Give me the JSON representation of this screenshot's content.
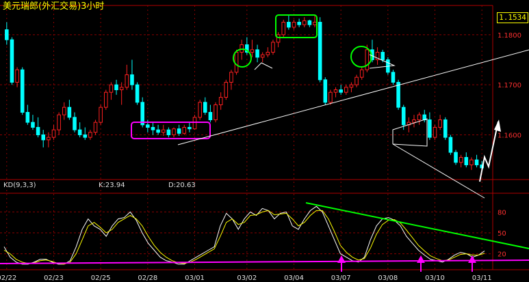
{
  "window": {
    "title": "美元瑞郎(外汇交易)3小时",
    "current_price": "1.1534"
  },
  "indicator": {
    "name": "KD(9,3,3)",
    "k_label": "K:23.94",
    "d_label": "D:20.63"
  },
  "colors": {
    "background": "#000000",
    "grid": "#8b0000",
    "up_candle": "#ff2020",
    "down_candle": "#00ffff",
    "title": "#ffff00",
    "k_line": "#ffffff",
    "d_line": "#ffff00",
    "annotation_green": "#00ff00",
    "annotation_magenta": "#ff00ff",
    "trendline": "#ffffff"
  },
  "chart_data": [
    {
      "type": "candlestick",
      "x_tick_labels": [
        "02/22",
        "02/23",
        "02/25",
        "02/28",
        "03/01",
        "03/02",
        "03/04",
        "03/07",
        "03/08",
        "03/10",
        "03/11"
      ],
      "y_tick_labels": [
        "1.1800",
        "1.1700",
        "1.1600"
      ],
      "ylim": [
        1.1512,
        1.1853
      ],
      "candles": [
        [
          1.181,
          1.1825,
          1.178,
          1.179
        ],
        [
          1.179,
          1.1795,
          1.17,
          1.1705
        ],
        [
          1.1705,
          1.1735,
          1.1695,
          1.173
        ],
        [
          1.173,
          1.1735,
          1.164,
          1.1645
        ],
        [
          1.1645,
          1.166,
          1.162,
          1.1625
        ],
        [
          1.1625,
          1.164,
          1.161,
          1.1615
        ],
        [
          1.1615,
          1.1635,
          1.1595,
          1.16
        ],
        [
          1.16,
          1.161,
          1.1575,
          1.159
        ],
        [
          1.159,
          1.1605,
          1.1575,
          1.1595
        ],
        [
          1.1595,
          1.162,
          1.159,
          1.161
        ],
        [
          1.161,
          1.1645,
          1.16,
          1.164
        ],
        [
          1.164,
          1.1665,
          1.163,
          1.1655
        ],
        [
          1.1655,
          1.167,
          1.163,
          1.1635
        ],
        [
          1.1635,
          1.1645,
          1.1605,
          1.161
        ],
        [
          1.161,
          1.1625,
          1.1595,
          1.16
        ],
        [
          1.16,
          1.1615,
          1.159,
          1.1595
        ],
        [
          1.1595,
          1.161,
          1.159,
          1.1605
        ],
        [
          1.1605,
          1.163,
          1.16,
          1.1625
        ],
        [
          1.1625,
          1.166,
          1.162,
          1.1655
        ],
        [
          1.1655,
          1.169,
          1.165,
          1.1685
        ],
        [
          1.1685,
          1.1705,
          1.167,
          1.17
        ],
        [
          1.17,
          1.171,
          1.168,
          1.169
        ],
        [
          1.169,
          1.1705,
          1.166,
          1.1695
        ],
        [
          1.1695,
          1.174,
          1.169,
          1.172
        ],
        [
          1.172,
          1.175,
          1.169,
          1.17
        ],
        [
          1.17,
          1.1705,
          1.166,
          1.1665
        ],
        [
          1.1665,
          1.1675,
          1.1615,
          1.162
        ],
        [
          1.162,
          1.163,
          1.1605,
          1.1615
        ],
        [
          1.1615,
          1.1625,
          1.16,
          1.161
        ],
        [
          1.161,
          1.162,
          1.16,
          1.1605
        ],
        [
          1.1605,
          1.162,
          1.1598,
          1.161
        ],
        [
          1.161,
          1.1615,
          1.1595,
          1.16
        ],
        [
          1.16,
          1.1615,
          1.1595,
          1.1612
        ],
        [
          1.1612,
          1.162,
          1.1598,
          1.1603
        ],
        [
          1.1603,
          1.162,
          1.16,
          1.1615
        ],
        [
          1.1615,
          1.1625,
          1.1605,
          1.1612
        ],
        [
          1.1612,
          1.164,
          1.161,
          1.1635
        ],
        [
          1.1635,
          1.167,
          1.163,
          1.1665
        ],
        [
          1.1665,
          1.1675,
          1.164,
          1.1645
        ],
        [
          1.1645,
          1.166,
          1.1625,
          1.163
        ],
        [
          1.163,
          1.1665,
          1.1625,
          1.166
        ],
        [
          1.166,
          1.1685,
          1.165,
          1.1675
        ],
        [
          1.1675,
          1.171,
          1.167,
          1.1705
        ],
        [
          1.1705,
          1.173,
          1.169,
          1.1725
        ],
        [
          1.1725,
          1.177,
          1.172,
          1.1765
        ],
        [
          1.1765,
          1.179,
          1.175,
          1.178
        ],
        [
          1.178,
          1.1795,
          1.176,
          1.1765
        ],
        [
          1.1765,
          1.179,
          1.1755,
          1.177
        ],
        [
          1.177,
          1.178,
          1.1745,
          1.1755
        ],
        [
          1.1755,
          1.1765,
          1.1745,
          1.176
        ],
        [
          1.176,
          1.1775,
          1.1755,
          1.1765
        ],
        [
          1.1765,
          1.179,
          1.176,
          1.1785
        ],
        [
          1.1785,
          1.1805,
          1.1775,
          1.18
        ],
        [
          1.18,
          1.183,
          1.1795,
          1.1825
        ],
        [
          1.1825,
          1.184,
          1.181,
          1.1815
        ],
        [
          1.1815,
          1.183,
          1.181,
          1.1825
        ],
        [
          1.1825,
          1.1832,
          1.1815,
          1.182
        ],
        [
          1.182,
          1.1835,
          1.1815,
          1.1828
        ],
        [
          1.1828,
          1.183,
          1.1815,
          1.182
        ],
        [
          1.182,
          1.184,
          1.1815,
          1.1825
        ],
        [
          1.1825,
          1.1835,
          1.1705,
          1.171
        ],
        [
          1.171,
          1.1715,
          1.166,
          1.1665
        ],
        [
          1.1665,
          1.169,
          1.166,
          1.1685
        ],
        [
          1.1685,
          1.1695,
          1.1675,
          1.169
        ],
        [
          1.169,
          1.17,
          1.168,
          1.1685
        ],
        [
          1.1685,
          1.17,
          1.168,
          1.1695
        ],
        [
          1.1695,
          1.1705,
          1.1685,
          1.17
        ],
        [
          1.17,
          1.172,
          1.1695,
          1.1715
        ],
        [
          1.1715,
          1.1735,
          1.171,
          1.173
        ],
        [
          1.173,
          1.178,
          1.1725,
          1.177
        ],
        [
          1.177,
          1.179,
          1.1745,
          1.175
        ],
        [
          1.175,
          1.1775,
          1.174,
          1.1765
        ],
        [
          1.1765,
          1.177,
          1.1745,
          1.175
        ],
        [
          1.175,
          1.1755,
          1.172,
          1.1725
        ],
        [
          1.1725,
          1.173,
          1.17,
          1.1705
        ],
        [
          1.1705,
          1.171,
          1.165,
          1.1655
        ],
        [
          1.1655,
          1.166,
          1.161,
          1.162
        ],
        [
          1.162,
          1.1635,
          1.1605,
          1.1625
        ],
        [
          1.1625,
          1.164,
          1.1615,
          1.163
        ],
        [
          1.163,
          1.1645,
          1.162,
          1.164
        ],
        [
          1.164,
          1.165,
          1.1625,
          1.163
        ],
        [
          1.163,
          1.1645,
          1.159,
          1.1595
        ],
        [
          1.1595,
          1.162,
          1.159,
          1.1615
        ],
        [
          1.1615,
          1.164,
          1.161,
          1.163
        ],
        [
          1.163,
          1.1635,
          1.159,
          1.1595
        ],
        [
          1.1595,
          1.16,
          1.156,
          1.1565
        ],
        [
          1.1565,
          1.157,
          1.154,
          1.1545
        ],
        [
          1.1545,
          1.156,
          1.1535,
          1.1555
        ],
        [
          1.1555,
          1.1565,
          1.1535,
          1.154
        ],
        [
          1.154,
          1.1555,
          1.153,
          1.155
        ],
        [
          1.155,
          1.156,
          1.1535,
          1.154
        ],
        [
          1.154,
          1.1548,
          1.1528,
          1.1534
        ]
      ]
    },
    {
      "type": "line",
      "name": "KD(9,3,3)",
      "y_tick_labels": [
        "80",
        "50",
        "20"
      ],
      "ylim": [
        0,
        100
      ],
      "series": [
        {
          "name": "K",
          "values": [
            30,
            15,
            8,
            5,
            5,
            8,
            12,
            12,
            8,
            5,
            5,
            10,
            30,
            55,
            70,
            60,
            55,
            45,
            60,
            70,
            72,
            80,
            68,
            50,
            35,
            25,
            15,
            10,
            8,
            5,
            5,
            10,
            15,
            20,
            25,
            30,
            60,
            78,
            70,
            55,
            70,
            80,
            75,
            85,
            82,
            70,
            78,
            80,
            60,
            55,
            70,
            82,
            88,
            80,
            60,
            40,
            20,
            15,
            10,
            8,
            15,
            40,
            60,
            70,
            72,
            68,
            60,
            45,
            35,
            25,
            18,
            12,
            10,
            8,
            12,
            18,
            22,
            20,
            15,
            18,
            23.94
          ]
        },
        {
          "name": "D",
          "values": [
            25,
            20,
            12,
            8,
            6,
            7,
            10,
            11,
            9,
            6,
            5,
            8,
            20,
            40,
            60,
            65,
            58,
            50,
            55,
            65,
            70,
            75,
            70,
            60,
            45,
            32,
            22,
            15,
            10,
            7,
            6,
            8,
            12,
            17,
            22,
            27,
            45,
            65,
            70,
            62,
            65,
            75,
            76,
            80,
            82,
            76,
            77,
            78,
            70,
            60,
            65,
            75,
            82,
            82,
            70,
            52,
            32,
            22,
            15,
            11,
            13,
            28,
            48,
            62,
            68,
            69,
            64,
            54,
            43,
            32,
            24,
            17,
            13,
            10,
            11,
            15,
            19,
            20,
            18,
            18,
            20.63
          ]
        }
      ]
    }
  ]
}
